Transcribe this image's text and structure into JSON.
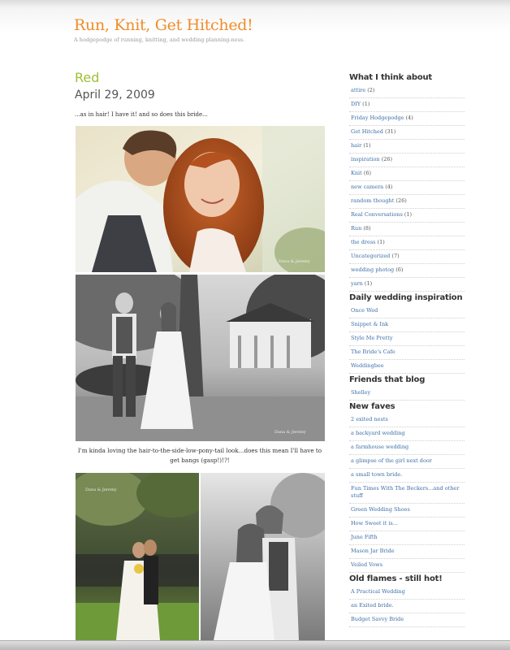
{
  "site": {
    "title": "Run, Knit, Get Hitched!",
    "tagline": "A hodgepodge of running, knitting, and wedding planning-ness."
  },
  "post": {
    "title": "Red",
    "date": "April 29, 2009",
    "intro": "...as in hair!  I have it!  and so does this bride...",
    "caption": "I'm kinda loving the hair-to-the-side-low-pony-tail look...does this mean I'll have to get bangs (gasp!)!?!",
    "watermark": "Dana & Jeremy"
  },
  "sidebar": {
    "categories": {
      "title": "What I think about",
      "items": [
        {
          "label": "attire",
          "count": "(2)"
        },
        {
          "label": "DIY",
          "count": "(1)"
        },
        {
          "label": "Friday Hodgepodge",
          "count": "(4)"
        },
        {
          "label": "Get Hitched",
          "count": "(31)"
        },
        {
          "label": "hair",
          "count": "(1)"
        },
        {
          "label": "inspiration",
          "count": "(26)"
        },
        {
          "label": "Knit",
          "count": "(6)"
        },
        {
          "label": "new camera",
          "count": "(4)"
        },
        {
          "label": "random thought",
          "count": "(26)"
        },
        {
          "label": "Real Conversations",
          "count": "(1)"
        },
        {
          "label": "Run",
          "count": "(8)"
        },
        {
          "label": "the dress",
          "count": "(1)"
        },
        {
          "label": "Uncategorized",
          "count": "(7)"
        },
        {
          "label": "wedding photog",
          "count": "(6)"
        },
        {
          "label": "yarn",
          "count": "(1)"
        }
      ]
    },
    "daily": {
      "title": "Daily wedding inspiration",
      "items": [
        "Once Wed",
        "Snippet & Ink",
        "Style Me Pretty",
        "The Bride's Cafe",
        "Weddingbee"
      ]
    },
    "friends": {
      "title": "Friends that blog",
      "items": [
        "Shelley"
      ]
    },
    "faves": {
      "title": "New faves",
      "items": [
        "2 exited nests",
        "a backyard wedding",
        "a farmhouse wedding",
        "a glimpse of the girl next door",
        "a small town bride.",
        "Fun Times With The Beckers...and other stuff",
        "Green Wedding Shoes",
        "How Sweet it is...",
        "June Fifth",
        "Mason Jar Bride",
        "Veiled Vows"
      ]
    },
    "old": {
      "title": "Old flames - still hot!",
      "items": [
        "A Practical Wedding",
        "an Exited bride.",
        "Budget Savvy Bride"
      ]
    }
  }
}
